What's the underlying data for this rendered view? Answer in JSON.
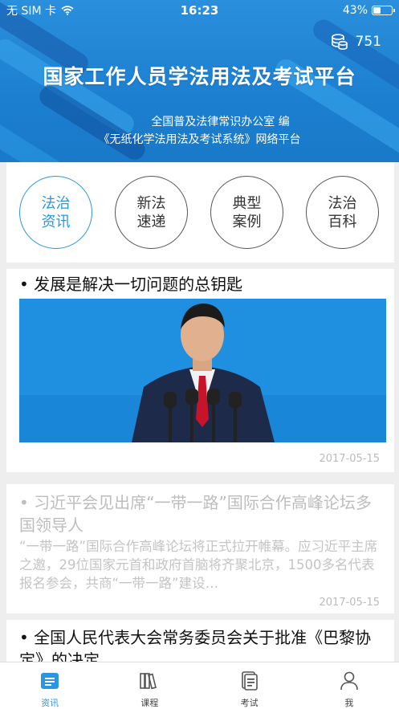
{
  "status_bar": {
    "carrier": "无 SIM 卡",
    "time": "16:23",
    "battery_percent_text": "43%",
    "battery_level": 0.43
  },
  "header": {
    "coins": "751",
    "title": "国家工作人员学法用法及考试平台",
    "subtitle_line1": "全国普及法律常识办公室 编",
    "subtitle_line2": "《无纸化学法用法及考试系统》网络平台",
    "colors": {
      "background": "#1c7fd0",
      "stripe_dark": "#1558a8",
      "stripe_light": "#3aa6ec"
    }
  },
  "categories": [
    {
      "line1": "法治",
      "line2": "资讯",
      "active": true
    },
    {
      "line1": "新法",
      "line2": "速递",
      "active": false
    },
    {
      "line1": "典型",
      "line2": "案例",
      "active": false
    },
    {
      "line1": "法治",
      "line2": "百科",
      "active": false
    }
  ],
  "articles": [
    {
      "title": "• 发展是解决一切问题的总钥匙",
      "has_image": true,
      "date": "2017-05-15",
      "read": false
    },
    {
      "title": "• 习近平会见出席“一带一路”国际合作高峰论坛多国领导人",
      "summary": "“一带一路”国际合作高峰论坛将正式拉开帷幕。应习近平主席之邀，29位国家元首和政府首脑将齐聚北京，1500多名代表报名参会，共商“一带一路”建设…",
      "date": "2017-05-15",
      "read": true
    },
    {
      "title": "• 全国人民代表大会常务委员会关于批准《巴黎协定》的决定",
      "read": false
    }
  ],
  "tabbar": [
    {
      "label": "资讯",
      "icon": "news-icon",
      "active": true
    },
    {
      "label": "课程",
      "icon": "books-icon",
      "active": false
    },
    {
      "label": "考试",
      "icon": "exam-paper-icon",
      "active": false
    },
    {
      "label": "我",
      "icon": "person-icon",
      "active": false
    }
  ],
  "accent_color": "#2a96e0"
}
